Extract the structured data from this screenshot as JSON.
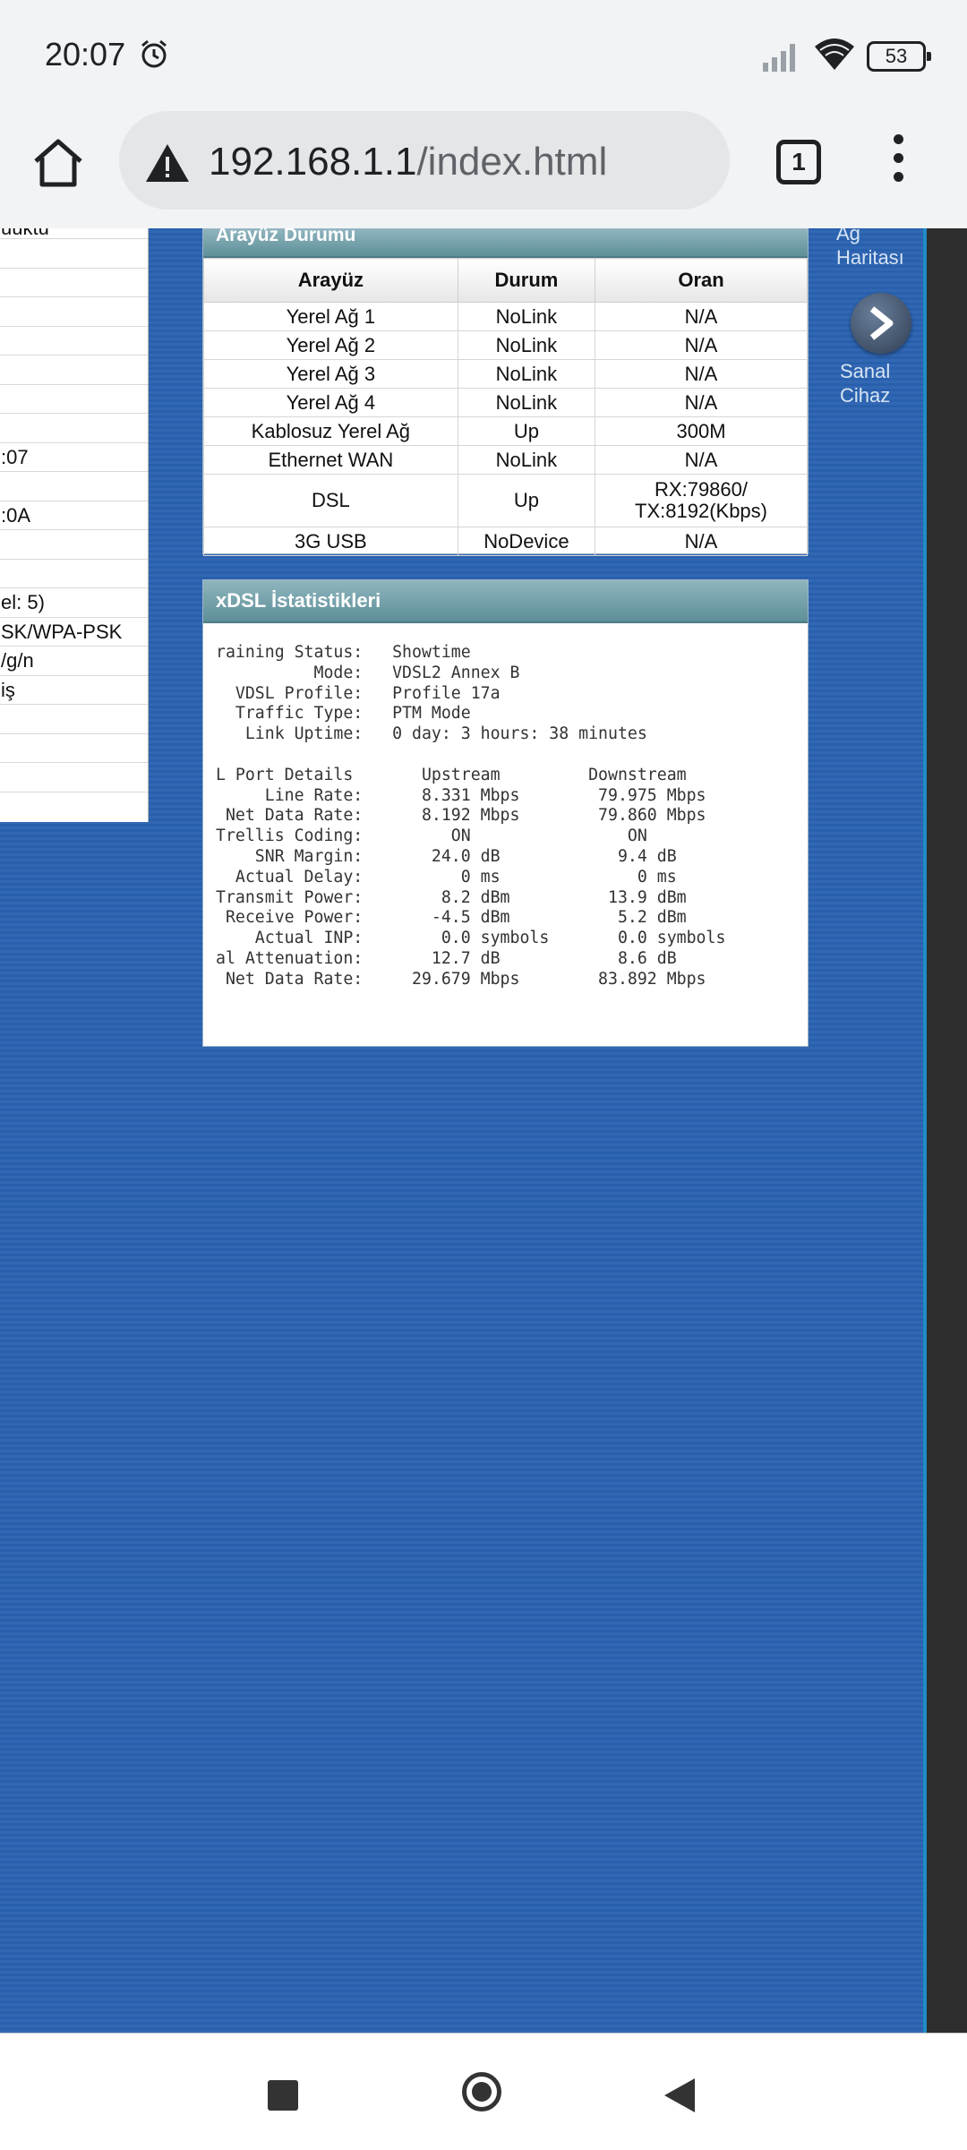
{
  "status_bar": {
    "time": "20:07",
    "battery": "53"
  },
  "browser": {
    "url_host": "192.168.1.1",
    "url_path": "/index.html",
    "tab_count": "1"
  },
  "left_panel": {
    "rows": [
      "uuktu",
      "",
      "",
      "",
      "",
      "",
      "",
      "",
      ":07",
      "",
      ":0A",
      "",
      "",
      "el: 5)",
      "SK/WPA-PSK",
      "/g/n",
      "iş",
      "",
      "",
      ""
    ]
  },
  "interface_status": {
    "title": "Arayüz Durumu",
    "headers": [
      "Arayüz",
      "Durum",
      "Oran"
    ],
    "rows": [
      {
        "iface": "Yerel Ağ 1",
        "status": "NoLink",
        "rate": "N/A"
      },
      {
        "iface": "Yerel Ağ 2",
        "status": "NoLink",
        "rate": "N/A"
      },
      {
        "iface": "Yerel Ağ 3",
        "status": "NoLink",
        "rate": "N/A"
      },
      {
        "iface": "Yerel Ağ 4",
        "status": "NoLink",
        "rate": "N/A"
      },
      {
        "iface": "Kablosuz Yerel Ağ",
        "status": "Up",
        "rate": "300M"
      },
      {
        "iface": "Ethernet WAN",
        "status": "NoLink",
        "rate": "N/A"
      },
      {
        "iface": "DSL",
        "status": "Up",
        "rate_line1": "RX:79860/",
        "rate_line2": "TX:8192(Kbps)"
      },
      {
        "iface": "3G USB",
        "status": "NoDevice",
        "rate": "N/A"
      }
    ]
  },
  "xdsl_stats": {
    "title": "xDSL İstatistikleri",
    "text": "raining Status:   Showtime\n          Mode:   VDSL2 Annex B\n  VDSL Profile:   Profile 17a\n  Traffic Type:   PTM Mode\n   Link Uptime:   0 day: 3 hours: 38 minutes\n\nL Port Details       Upstream         Downstream\n     Line Rate:      8.331 Mbps        79.975 Mbps\n Net Data Rate:      8.192 Mbps        79.860 Mbps\nTrellis Coding:         ON                ON\n    SNR Margin:       24.0 dB            9.4 dB\n  Actual Delay:          0 ms              0 ms\nTransmit Power:        8.2 dBm          13.9 dBm\n Receive Power:       -4.5 dBm           5.2 dBm\n    Actual INP:        0.0 symbols       0.0 symbols\nal Attenuation:       12.7 dB            8.6 dB\n Net Data Rate:     29.679 Mbps        83.892 Mbps"
  },
  "right_nav": {
    "item1": "Ağ\nHaritası",
    "item2": "Sanal\nCihaz"
  }
}
